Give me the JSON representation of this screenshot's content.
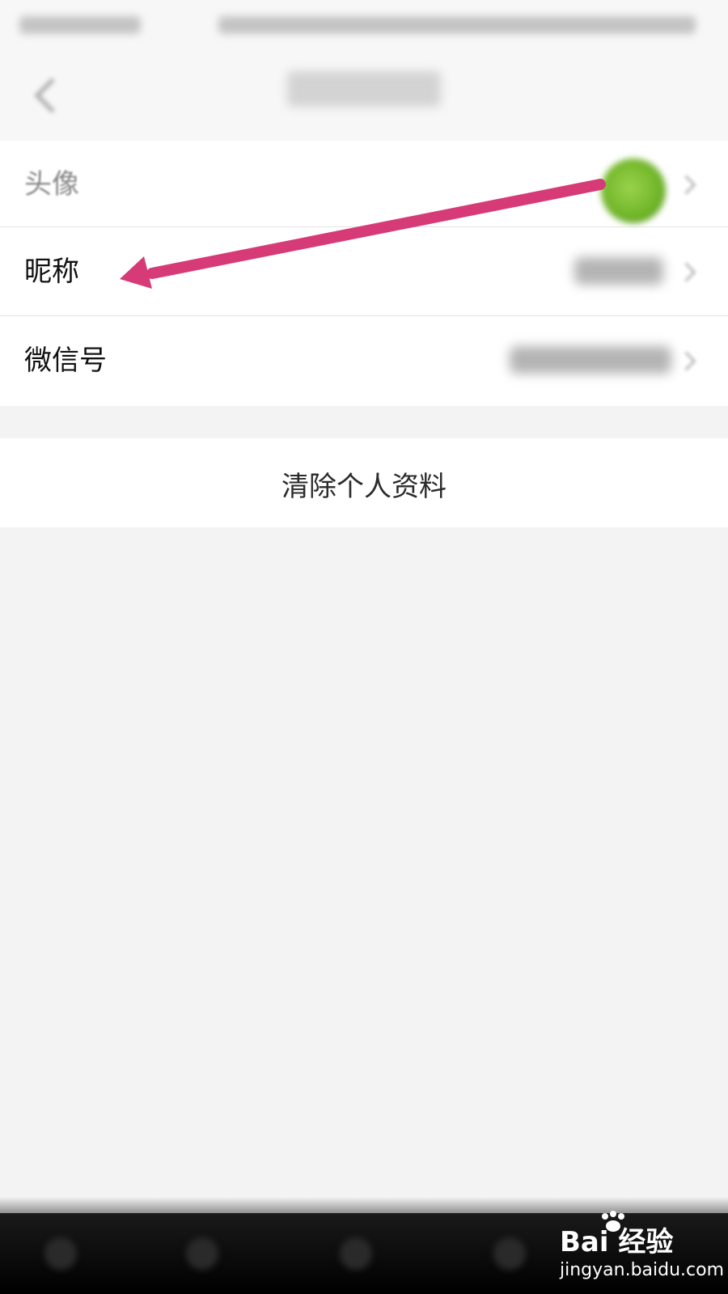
{
  "rows": {
    "avatar_label": "头像",
    "nickname_label": "昵称",
    "wechat_id_label": "微信号"
  },
  "clear_button": {
    "label": "清除个人资料"
  },
  "watermark": {
    "brand": "Bai 经验",
    "url": "jingyan.baidu.com"
  },
  "colors": {
    "annotation_arrow": "#d63b78",
    "background": "#f3f3f3",
    "avatar": "#7ec236"
  },
  "icons": [
    "back-arrow-icon",
    "chevron-right-icon",
    "baidu-paw-icon"
  ]
}
